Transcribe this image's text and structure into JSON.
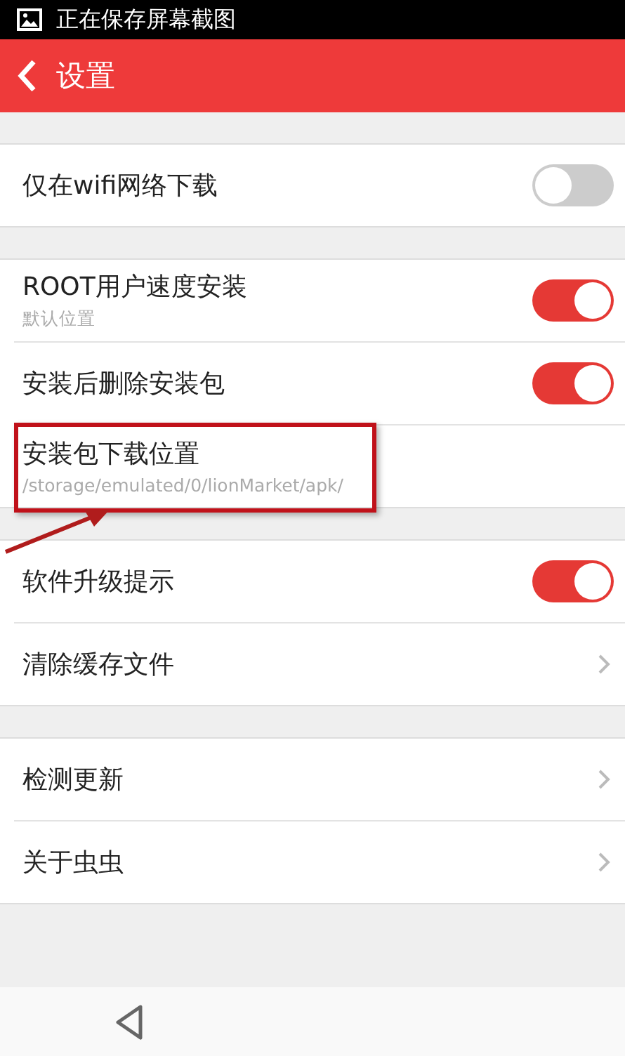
{
  "status_bar": {
    "notification": "正在保存屏幕截图"
  },
  "header": {
    "title": "设置"
  },
  "groups": [
    {
      "items": [
        {
          "kind": "toggle",
          "label": "仅在wifi网络下载",
          "on": false
        }
      ]
    },
    {
      "items": [
        {
          "kind": "toggle",
          "label": "ROOT用户速度安装",
          "subtitle": "默认位置",
          "on": true
        },
        {
          "kind": "toggle",
          "label": "安装后删除安装包",
          "on": true
        },
        {
          "kind": "plain",
          "label": "安装包下载位置",
          "subtitle": "/storage/emulated/0/lionMarket/apk/",
          "highlighted": true
        }
      ]
    },
    {
      "items": [
        {
          "kind": "toggle",
          "label": "软件升级提示",
          "on": true
        },
        {
          "kind": "link",
          "label": "清除缓存文件"
        }
      ]
    },
    {
      "items": [
        {
          "kind": "link",
          "label": "检测更新"
        },
        {
          "kind": "link",
          "label": "关于虫虫"
        }
      ]
    }
  ]
}
